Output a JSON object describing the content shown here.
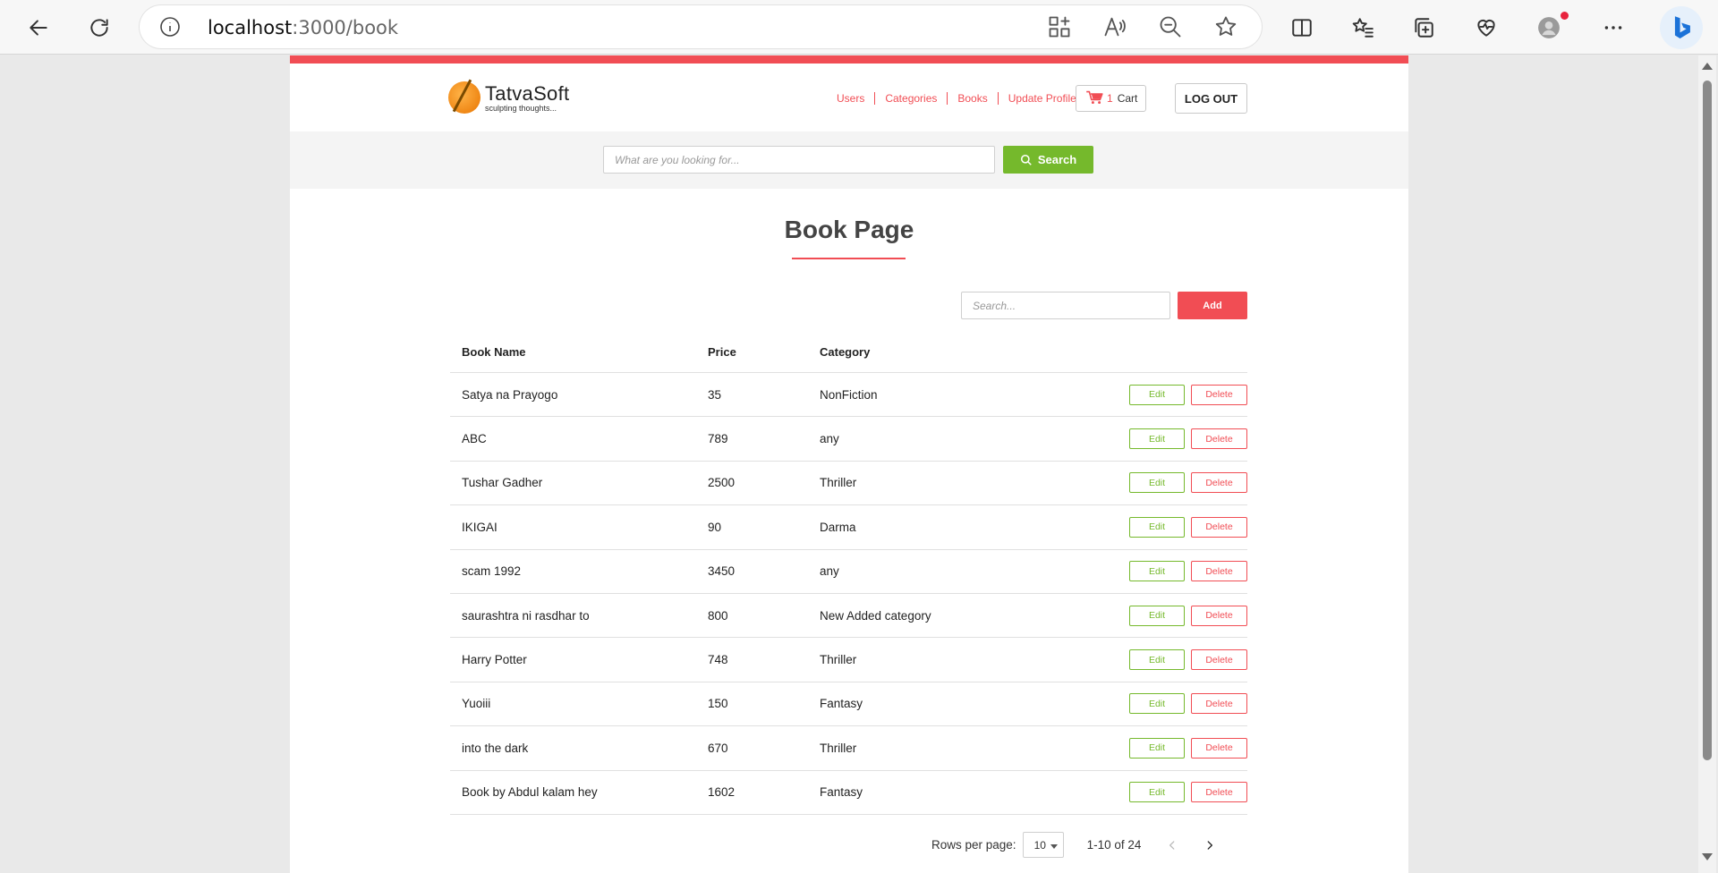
{
  "browser": {
    "url_host": "localhost",
    "url_path": ":3000/book"
  },
  "brand": {
    "name": "TatvaSoft",
    "tagline": "sculpting thoughts...",
    "accent_color": "#f14d54",
    "green_color": "#75b92c"
  },
  "nav": {
    "items": [
      {
        "label": "Users"
      },
      {
        "label": "Categories"
      },
      {
        "label": "Books"
      },
      {
        "label": "Update Profile"
      }
    ],
    "cart_count": "1",
    "cart_label": "Cart",
    "logout_label": "LOG OUT"
  },
  "search": {
    "placeholder": "What are you looking for...",
    "button_label": "Search"
  },
  "page": {
    "title": "Book Page",
    "table_search_placeholder": "Search...",
    "add_label": "Add"
  },
  "table": {
    "headers": {
      "name": "Book Name",
      "price": "Price",
      "category": "Category"
    },
    "edit_label": "Edit",
    "delete_label": "Delete",
    "rows": [
      {
        "name": "Satya na Prayogo",
        "price": "35",
        "category": "NonFiction"
      },
      {
        "name": "ABC",
        "price": "789",
        "category": "any"
      },
      {
        "name": "Tushar Gadher",
        "price": "2500",
        "category": "Thriller"
      },
      {
        "name": "IKIGAI",
        "price": "90",
        "category": "Darma"
      },
      {
        "name": "scam 1992",
        "price": "3450",
        "category": "any"
      },
      {
        "name": "saurashtra ni rasdhar to",
        "price": "800",
        "category": "New Added category"
      },
      {
        "name": "Harry Potter",
        "price": "748",
        "category": "Thriller"
      },
      {
        "name": "Yuoiii",
        "price": "150",
        "category": "Fantasy"
      },
      {
        "name": "into the dark",
        "price": "670",
        "category": "Thriller"
      },
      {
        "name": "Book by Abdul kalam hey",
        "price": "1602",
        "category": "Fantasy"
      }
    ]
  },
  "pagination": {
    "rows_per_page_label": "Rows per page:",
    "rows_per_page_value": "10",
    "range": "1-10 of 24"
  }
}
